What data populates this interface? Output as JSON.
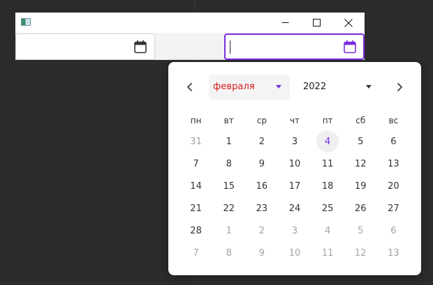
{
  "window": {
    "minimize_icon": "minimize-icon",
    "maximize_icon": "maximize-icon",
    "close_icon": "close-icon"
  },
  "fields": [
    {
      "value": "",
      "icon": "calendar-icon"
    },
    {
      "value": "",
      "icon": "calendar-icon",
      "focused": true
    }
  ],
  "colors": {
    "accent": "#7a2de0",
    "month_text": "#d81b1b",
    "muted_day": "#a3a3a3"
  },
  "calendar": {
    "month": "февраля",
    "year": "2022",
    "weekdays": [
      "пн",
      "вт",
      "ср",
      "чт",
      "пт",
      "сб",
      "вс"
    ],
    "today": "4",
    "days": [
      {
        "n": "31",
        "other": true
      },
      {
        "n": "1"
      },
      {
        "n": "2"
      },
      {
        "n": "3"
      },
      {
        "n": "4",
        "today": true
      },
      {
        "n": "5"
      },
      {
        "n": "6"
      },
      {
        "n": "7"
      },
      {
        "n": "8"
      },
      {
        "n": "9"
      },
      {
        "n": "10"
      },
      {
        "n": "11"
      },
      {
        "n": "12"
      },
      {
        "n": "13"
      },
      {
        "n": "14"
      },
      {
        "n": "15"
      },
      {
        "n": "16"
      },
      {
        "n": "17"
      },
      {
        "n": "18"
      },
      {
        "n": "19"
      },
      {
        "n": "20"
      },
      {
        "n": "21"
      },
      {
        "n": "22"
      },
      {
        "n": "23"
      },
      {
        "n": "24"
      },
      {
        "n": "25"
      },
      {
        "n": "26"
      },
      {
        "n": "27"
      },
      {
        "n": "28"
      },
      {
        "n": "1",
        "other": true
      },
      {
        "n": "2",
        "other": true
      },
      {
        "n": "3",
        "other": true
      },
      {
        "n": "4",
        "other": true
      },
      {
        "n": "5",
        "other": true
      },
      {
        "n": "6",
        "other": true
      },
      {
        "n": "7",
        "other": true
      },
      {
        "n": "8",
        "other": true
      },
      {
        "n": "9",
        "other": true
      },
      {
        "n": "10",
        "other": true
      },
      {
        "n": "11",
        "other": true
      },
      {
        "n": "12",
        "other": true
      },
      {
        "n": "13",
        "other": true
      }
    ]
  }
}
